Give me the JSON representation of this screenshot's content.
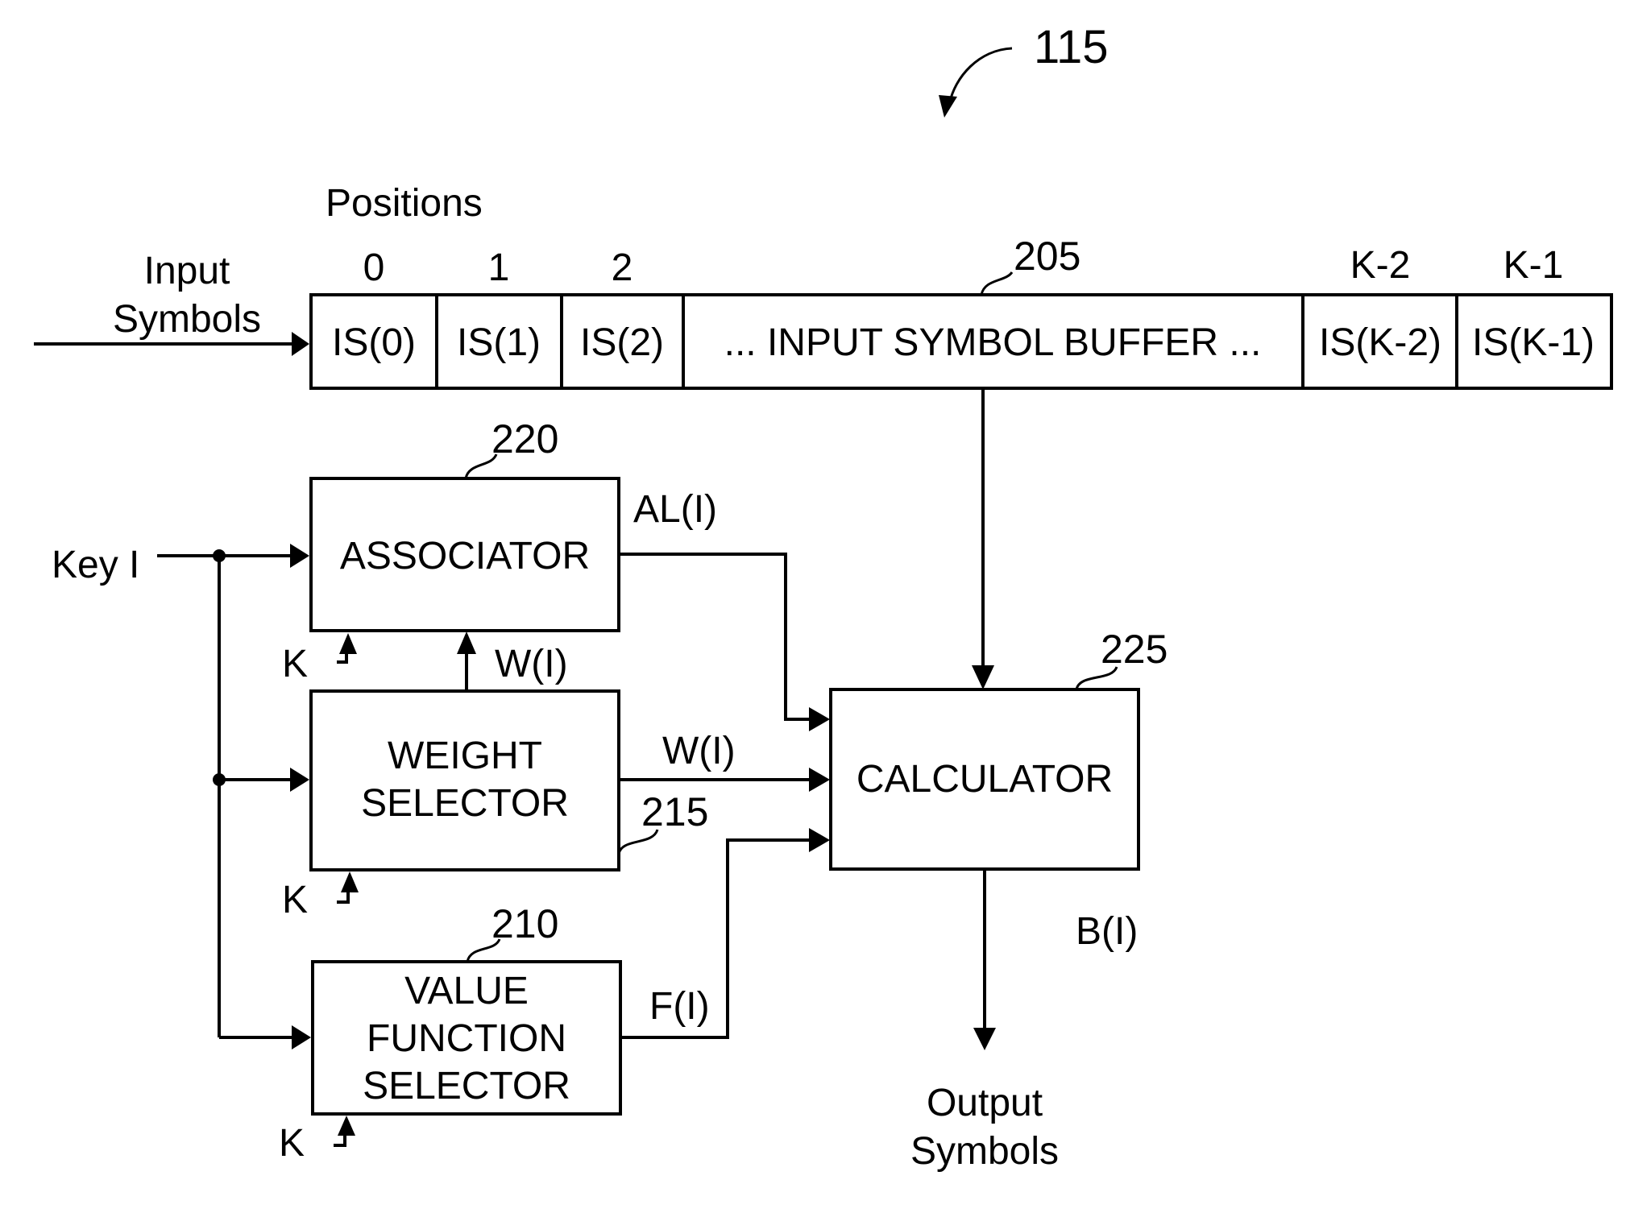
{
  "figure": {
    "reference": "115"
  },
  "buffer": {
    "reference": "205",
    "positions_label": "Positions",
    "input_label_line1": "Input",
    "input_label_line2": "Symbols",
    "cells": [
      {
        "position": "0",
        "label": "IS(0)"
      },
      {
        "position": "1",
        "label": "IS(1)"
      },
      {
        "position": "2",
        "label": "IS(2)"
      },
      {
        "position": "",
        "label": "... INPUT SYMBOL BUFFER ..."
      },
      {
        "position": "K-2",
        "label": "IS(K-2)"
      },
      {
        "position": "K-1",
        "label": "IS(K-1)"
      }
    ]
  },
  "blocks": {
    "associator": {
      "reference": "220",
      "lines": [
        "ASSOCIATOR"
      ],
      "k_label": "K"
    },
    "weight_selector": {
      "reference": "215",
      "lines": [
        "WEIGHT",
        "SELECTOR"
      ],
      "k_label": "K"
    },
    "value_function_selector": {
      "reference": "210",
      "lines": [
        "VALUE",
        "FUNCTION",
        "SELECTOR"
      ],
      "k_label": "K"
    },
    "calculator": {
      "reference": "225",
      "lines": [
        "CALCULATOR"
      ]
    }
  },
  "signals": {
    "key": "Key I",
    "associator_out": "AL(I)",
    "weight_to_associator": "W(I)",
    "weight_out": "W(I)",
    "value_function_out": "F(I)",
    "calculator_out": "B(I)",
    "output_line1": "Output",
    "output_line2": "Symbols"
  }
}
